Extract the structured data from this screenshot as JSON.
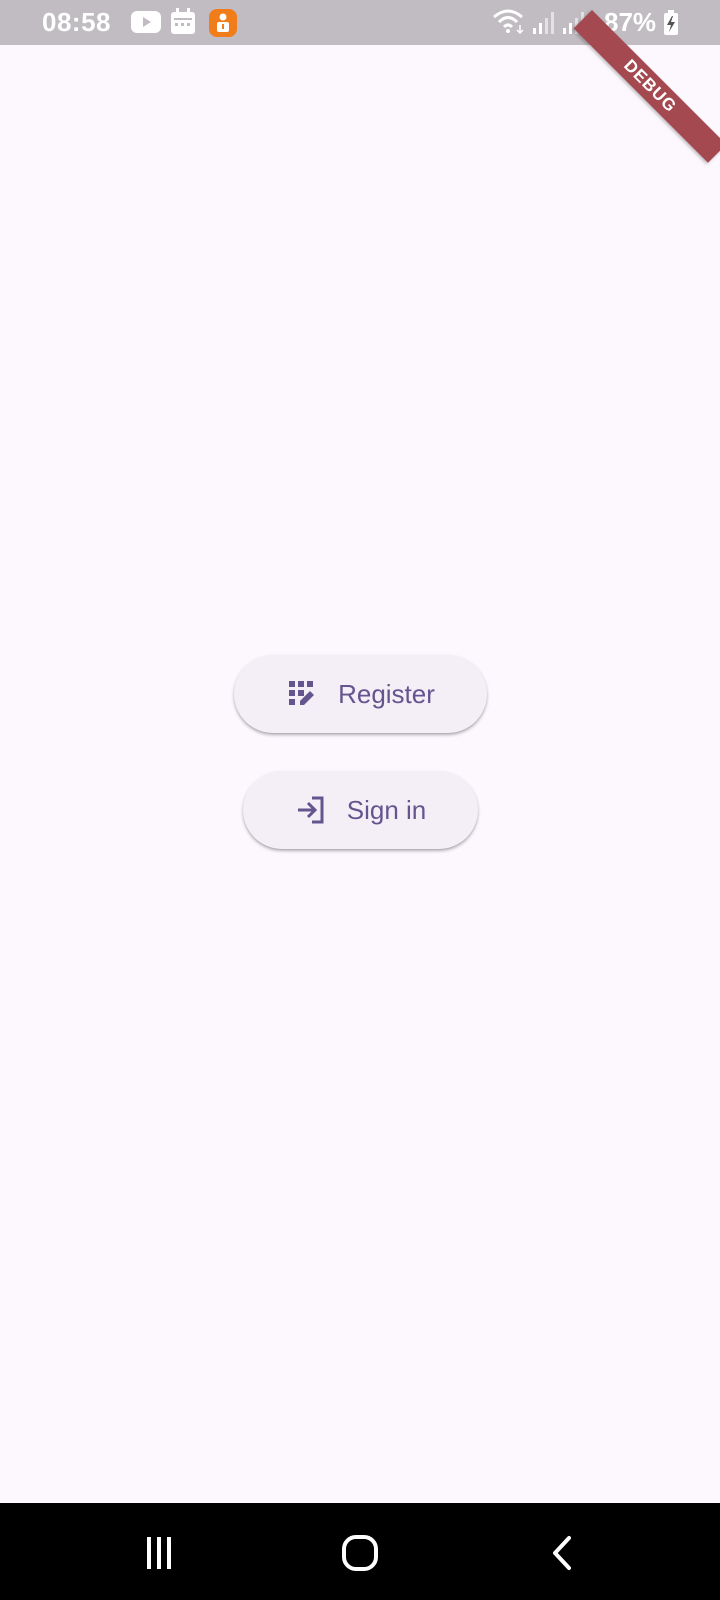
{
  "status_bar": {
    "time": "08:58",
    "battery_percent": "87%",
    "icons": [
      "youtube-icon",
      "calendar-icon",
      "notification-app-icon",
      "wifi-icon",
      "signal-icon",
      "signal-icon",
      "battery-charging-icon"
    ]
  },
  "debug_banner": {
    "label": "DEBUG"
  },
  "main": {
    "register_button": {
      "label": "Register",
      "icon": "app-registration-icon"
    },
    "signin_button": {
      "label": "Sign in",
      "icon": "login-icon"
    }
  },
  "nav_bar": {
    "icons": [
      "recent-apps-icon",
      "home-icon",
      "back-icon"
    ]
  },
  "colors": {
    "background": "#fdf7fe",
    "button_bg": "#f4eff7",
    "button_text": "#65558f",
    "status_bar_bg": "#c0bcc2",
    "debug_ribbon": "#a4494f",
    "nav_bar_bg": "#000000"
  }
}
